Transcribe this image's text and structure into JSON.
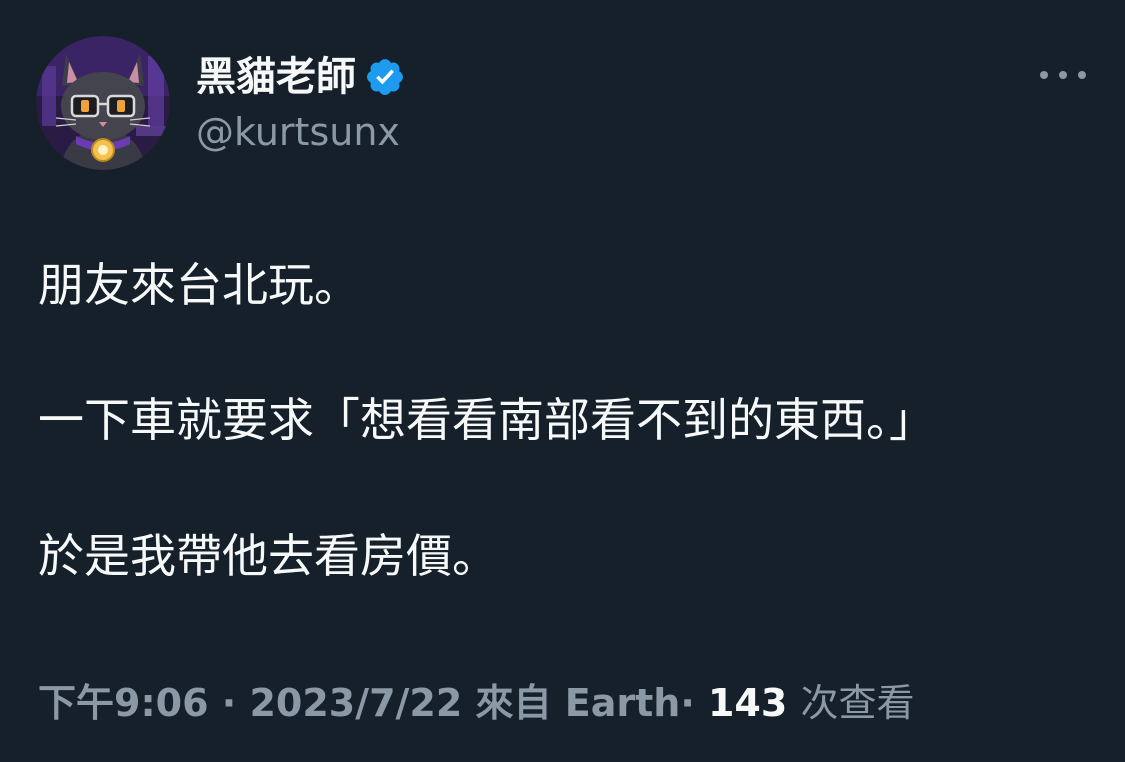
{
  "author": {
    "display_name": "黑貓老師",
    "handle": "@kurtsunx",
    "verified": true,
    "verified_color": "#1d9bf0",
    "avatar_icon": "black-cat-with-glasses-avatar"
  },
  "tweet": {
    "lines": [
      "朋友來台北玩。",
      "一下車就要求「想看看南部看不到的東西。」",
      "於是我帶他去看房價。"
    ]
  },
  "meta": {
    "time": "下午9:06",
    "date": "2023/7/22",
    "source": "來自 Earth",
    "separator": "·",
    "views_count": "143",
    "views_label": "次查看"
  },
  "colors": {
    "background": "#15202b",
    "primary_text": "#f7f9f9",
    "secondary_text": "#8b98a5"
  }
}
